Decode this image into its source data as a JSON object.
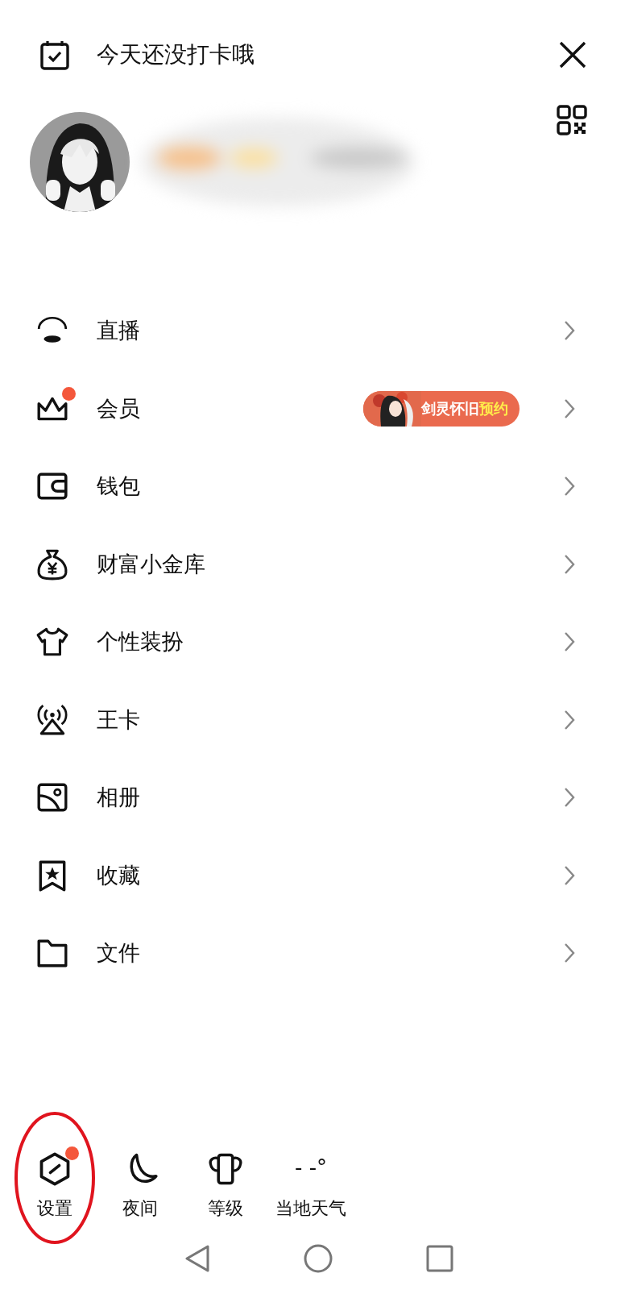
{
  "header": {
    "title": "今天还没打卡哦"
  },
  "menu": [
    {
      "label": "直播",
      "dot": false
    },
    {
      "label": "会员",
      "dot": true,
      "promo": {
        "text": "剑灵怀旧",
        "highlight": "预约"
      }
    },
    {
      "label": "钱包",
      "dot": false
    },
    {
      "label": "财富小金库",
      "dot": false
    },
    {
      "label": "个性装扮",
      "dot": false
    },
    {
      "label": "王卡",
      "dot": false
    },
    {
      "label": "相册",
      "dot": false
    },
    {
      "label": "收藏",
      "dot": false
    },
    {
      "label": "文件",
      "dot": false
    }
  ],
  "tools": [
    {
      "label": "设置",
      "dot": true,
      "circled": true
    },
    {
      "label": "夜间",
      "dot": false,
      "circled": false
    },
    {
      "label": "等级",
      "dot": false,
      "circled": false
    },
    {
      "label": "当地天气",
      "dot": false,
      "circled": false,
      "reading": "- -°"
    }
  ]
}
